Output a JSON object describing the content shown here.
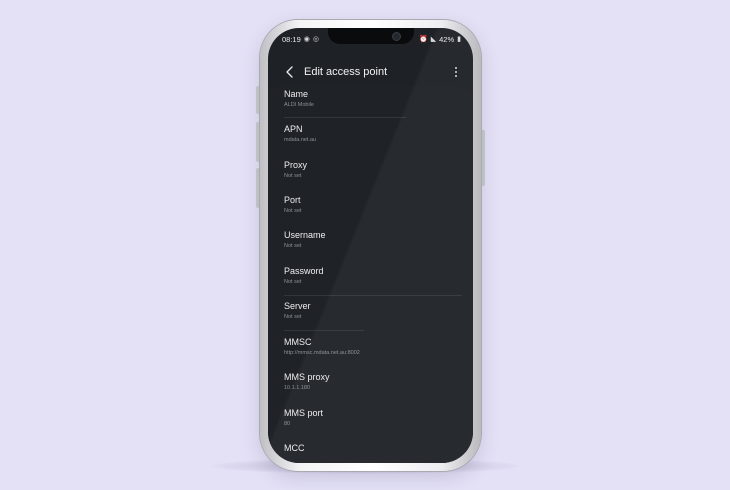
{
  "status_bar": {
    "time": "08:19",
    "notif_icons": [
      "messenger-icon",
      "notification-icon"
    ],
    "battery": "42%"
  },
  "app_bar": {
    "title": "Edit access point"
  },
  "settings": [
    {
      "label": "Name",
      "value": "ALDI Mobile"
    },
    {
      "label": "APN",
      "value": "mdata.net.au"
    },
    {
      "label": "Proxy",
      "value": "Not set"
    },
    {
      "label": "Port",
      "value": "Not set"
    },
    {
      "label": "Username",
      "value": "Not set"
    },
    {
      "label": "Password",
      "value": "Not set"
    },
    {
      "label": "Server",
      "value": "Not set"
    },
    {
      "label": "MMSC",
      "value": "http://mmsc.mdata.net.au:8002"
    },
    {
      "label": "MMS proxy",
      "value": "10.1.1.180"
    },
    {
      "label": "MMS port",
      "value": "80"
    },
    {
      "label": "MCC",
      "value": ""
    }
  ],
  "colors": {
    "background": "#e4e1f6",
    "screen": "#1e2126",
    "text_primary": "#eeeef0",
    "text_secondary": "#8d9097"
  }
}
